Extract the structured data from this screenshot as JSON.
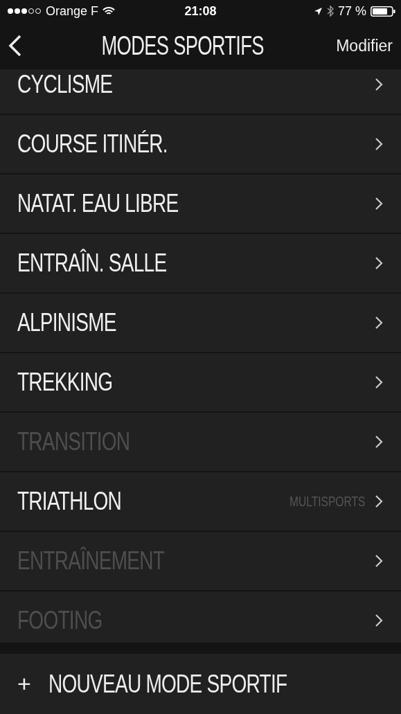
{
  "status_bar": {
    "carrier": "Orange F",
    "time": "21:08",
    "battery": "77 %"
  },
  "nav": {
    "title": "MODES SPORTIFS",
    "action": "Modifier"
  },
  "modes": [
    {
      "label": "CYCLISME",
      "disabled": false
    },
    {
      "label": "COURSE ITINÉR.",
      "disabled": false
    },
    {
      "label": "NATAT. EAU LIBRE",
      "disabled": false
    },
    {
      "label": "ENTRAÎN. SALLE",
      "disabled": false
    },
    {
      "label": "ALPINISME",
      "disabled": false
    },
    {
      "label": "TREKKING",
      "disabled": false
    },
    {
      "label": "TRANSITION",
      "disabled": true
    },
    {
      "label": "TRIATHLON",
      "disabled": false,
      "badge": "MULTISPORTS"
    },
    {
      "label": "ENTRAÎNEMENT",
      "disabled": true
    },
    {
      "label": "FOOTING",
      "disabled": true
    }
  ],
  "add_button": {
    "icon": "+",
    "label": "NOUVEAU MODE SPORTIF"
  }
}
